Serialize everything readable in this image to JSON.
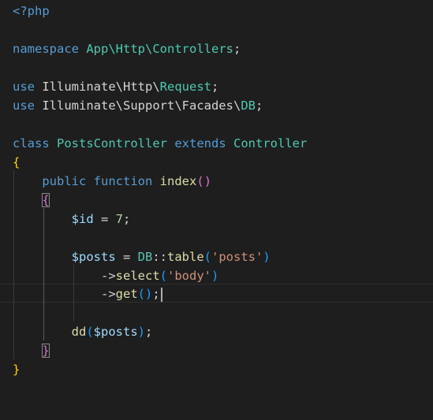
{
  "editor": {
    "code": {
      "open_tag": "<?php",
      "namespace_kw": "namespace",
      "namespace_path": "App\\Http\\Controllers",
      "semicolon": ";",
      "use_kw": "use",
      "use1_path": "Illuminate\\Http\\",
      "use1_class": "Request",
      "use2_path": "Illuminate\\Support\\Facades\\",
      "use2_class": "DB",
      "class_kw": "class",
      "class_name": "PostsController",
      "extends_kw": "extends",
      "parent_class": "Controller",
      "brace_open": "{",
      "brace_close": "}",
      "public_kw": "public",
      "function_kw": "function",
      "method_name": "index",
      "paren_open": "(",
      "paren_close": ")",
      "var_id": "$id",
      "assign": " = ",
      "num_7": "7",
      "var_posts": "$posts",
      "db_class": "DB",
      "scope_op": "::",
      "table_fn": "table",
      "str_posts": "'posts'",
      "arrow": "->",
      "select_fn": "select",
      "str_body": "'body'",
      "get_fn": "get",
      "dd_fn": "dd"
    }
  }
}
